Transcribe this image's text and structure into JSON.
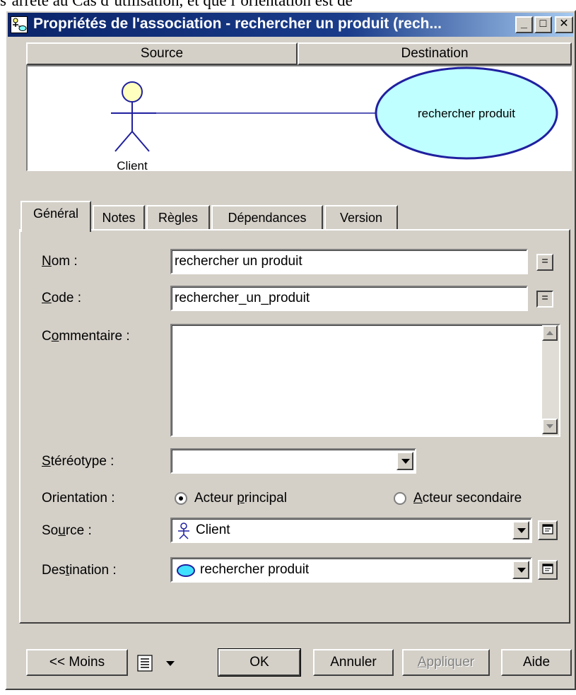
{
  "top_strip_text": "s’arrête au Cas d’utilisation, et que l’orientation est de",
  "window": {
    "title": "Propriétés de l'association - rechercher un produit (rech...",
    "minimize_label": "_",
    "maximize_label": "□",
    "close_label": "✕"
  },
  "header_tabs": {
    "source": "Source",
    "destination": "Destination"
  },
  "diagram": {
    "actor_label": "Client",
    "usecase_label": "rechercher produit",
    "colors": {
      "line": "#2020a0",
      "actor_head": "#ffffc0",
      "usecase_fill": "#c0ffff"
    }
  },
  "tabs": [
    {
      "label": "Général",
      "active": true
    },
    {
      "label": "Notes"
    },
    {
      "label": "Règles"
    },
    {
      "label": "Dépendances"
    },
    {
      "label": "Version"
    }
  ],
  "form": {
    "nom": {
      "mnemonic": "N",
      "rest": "om :",
      "value": "rechercher un produit",
      "button": "="
    },
    "code": {
      "mnemonic": "C",
      "rest": "ode :",
      "value": "rechercher_un_produit",
      "button": "="
    },
    "commentaire": {
      "before": "C",
      "mnemonic": "o",
      "rest": "mmentaire :",
      "value": ""
    },
    "stereotype": {
      "mnemonic": "S",
      "rest": "téréotype :",
      "value": ""
    },
    "orientation": {
      "label": "Orientation :",
      "principal": {
        "before": "Acteur ",
        "mnemonic": "p",
        "rest": "rincipal",
        "checked": true
      },
      "secondaire": {
        "mnemonic": "A",
        "rest": "cteur secondaire",
        "checked": false
      }
    },
    "source": {
      "before": "So",
      "mnemonic": "u",
      "rest": "rce :",
      "value": "Client",
      "icon": "actor-icon"
    },
    "destination": {
      "before": "Des",
      "mnemonic": "t",
      "rest": "ination :",
      "value": "rechercher produit",
      "icon": "usecase-icon"
    }
  },
  "buttons": {
    "moins": "<< Moins",
    "ok": "OK",
    "annuler": "Annuler",
    "appliquer_mnemonic": "A",
    "appliquer_rest": "ppliquer",
    "aide": "Aide"
  }
}
